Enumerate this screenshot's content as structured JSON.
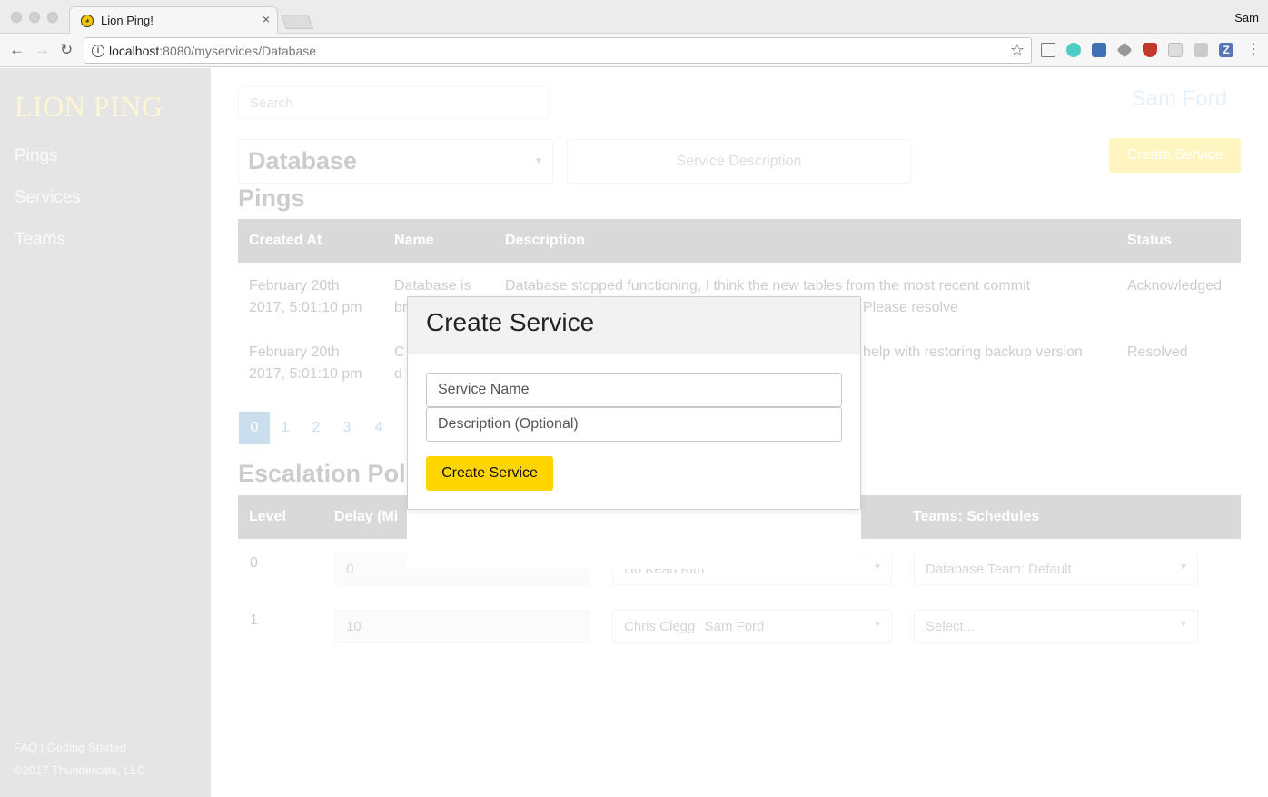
{
  "browser": {
    "tab_title": "Lion Ping!",
    "tab_close": "×",
    "profile_name": "Sam",
    "url_host": "localhost",
    "url_path": ":8080/myservices/Database",
    "star_glyph": "☆"
  },
  "sidebar": {
    "brand": "LION PING",
    "items": [
      {
        "label": "Pings"
      },
      {
        "label": "Services"
      },
      {
        "label": "Teams"
      }
    ],
    "footer_links": "FAQ | Getting Started",
    "copyright": "©2017 Thundercats, LLC"
  },
  "header": {
    "search_placeholder": "Search",
    "account_name": "Sam Ford"
  },
  "service_bar": {
    "selected_service": "Database",
    "description_placeholder": "Service Description",
    "create_button": "Create Service"
  },
  "pings": {
    "heading": "Pings",
    "columns": [
      "Created At",
      "Name",
      "Description",
      "Status"
    ],
    "rows": [
      {
        "created_line1": "February 20th",
        "created_line2": "2017, 5:01:10 pm",
        "name_line1": "Database is",
        "name_line2": "br",
        "desc_line1": "Database stopped functioning, I think the new tables from the most recent commit",
        "desc_line2": "Please resolve",
        "status": "Acknowledged"
      },
      {
        "created_line1": "February 20th",
        "created_line2": "2017, 5:01:10 pm",
        "name_line1": "C",
        "name_line2": "d",
        "desc_line1": "help with restoring backup version",
        "status": "Resolved"
      }
    ],
    "pages": [
      "0",
      "1",
      "2",
      "3",
      "4"
    ]
  },
  "escalation": {
    "heading": "Escalation Polic",
    "columns": [
      "Level",
      "Delay (Mi",
      "Teams: Schedules"
    ],
    "rows": [
      {
        "level": "0",
        "delay": "0",
        "users": [
          "Ho Kean Kim"
        ],
        "team": "Database Team: Default"
      },
      {
        "level": "1",
        "delay": "10",
        "users": [
          "Chris Clegg",
          "Sam Ford"
        ],
        "team": "Select..."
      }
    ]
  },
  "modal": {
    "title": "Create Service",
    "name_placeholder": "Service Name",
    "description_placeholder": "Description (Optional)",
    "submit": "Create Service"
  },
  "colors": {
    "accent_yellow": "#ffd500",
    "link_blue": "#2a7ab8",
    "sidebar_bg": "#e5e5e5"
  }
}
